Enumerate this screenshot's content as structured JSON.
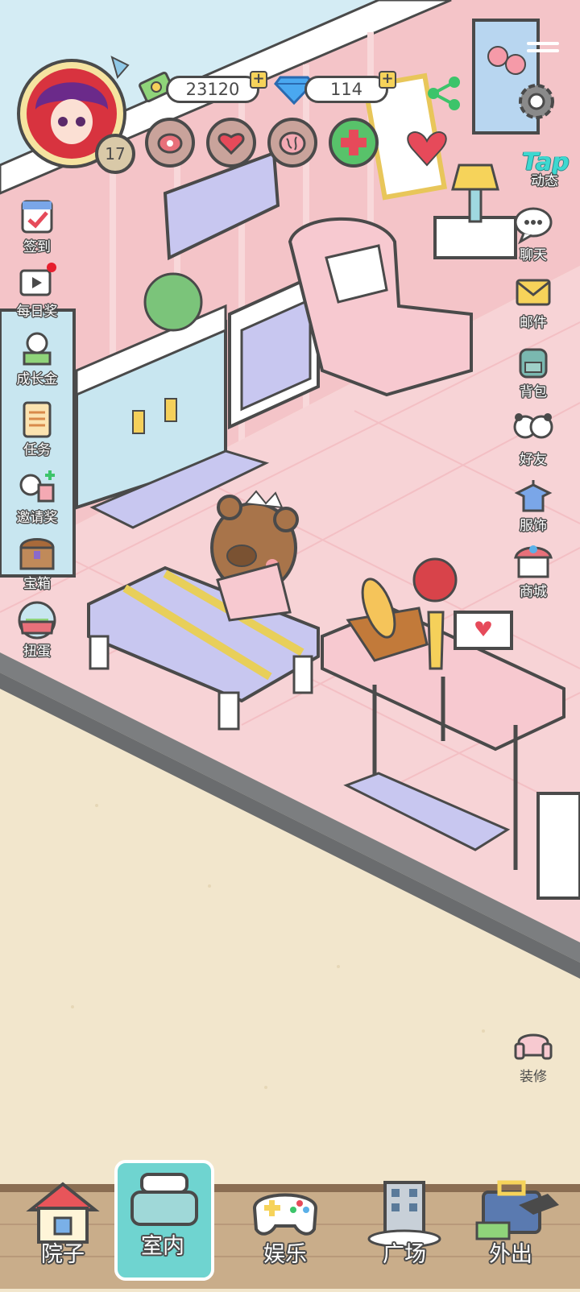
{
  "player": {
    "level": "17"
  },
  "currency": {
    "coins": "23120",
    "diamonds": "114"
  },
  "left_menu": [
    {
      "label": "签到",
      "icon": "calendar-check-icon"
    },
    {
      "label": "每日奖",
      "icon": "video-reward-icon"
    },
    {
      "label": "成长金",
      "icon": "growth-fund-icon"
    },
    {
      "label": "任务",
      "icon": "task-scroll-icon"
    },
    {
      "label": "邀请奖",
      "icon": "invite-gift-icon"
    },
    {
      "label": "宝箱",
      "icon": "treasure-chest-icon"
    },
    {
      "label": "扭蛋",
      "icon": "gacha-machine-icon"
    }
  ],
  "right_menu": [
    {
      "label": "动态",
      "icon": "tap-icon",
      "tap_text": "Tap"
    },
    {
      "label": "聊天",
      "icon": "chat-bubble-icon"
    },
    {
      "label": "邮件",
      "icon": "mail-icon"
    },
    {
      "label": "背包",
      "icon": "backpack-icon"
    },
    {
      "label": "好友",
      "icon": "friends-icon"
    },
    {
      "label": "服饰",
      "icon": "clothing-icon"
    },
    {
      "label": "商城",
      "icon": "shop-icon"
    }
  ],
  "decorate": {
    "label": "装修",
    "icon": "sofa-icon"
  },
  "bottom_nav": [
    {
      "label": "院子",
      "icon": "house-icon"
    },
    {
      "label": "室内",
      "icon": "bed-icon"
    },
    {
      "label": "娱乐",
      "icon": "gamepad-icon"
    },
    {
      "label": "广场",
      "icon": "building-icon"
    },
    {
      "label": "外出",
      "icon": "suitcase-icon"
    }
  ],
  "colors": {
    "wall_pink": "#f4c4c8",
    "floor_pink": "#f7d3d6",
    "outside_sand": "#f2e6cc",
    "outline": "#4a4a4a",
    "accent_teal": "#6fd4d0"
  }
}
